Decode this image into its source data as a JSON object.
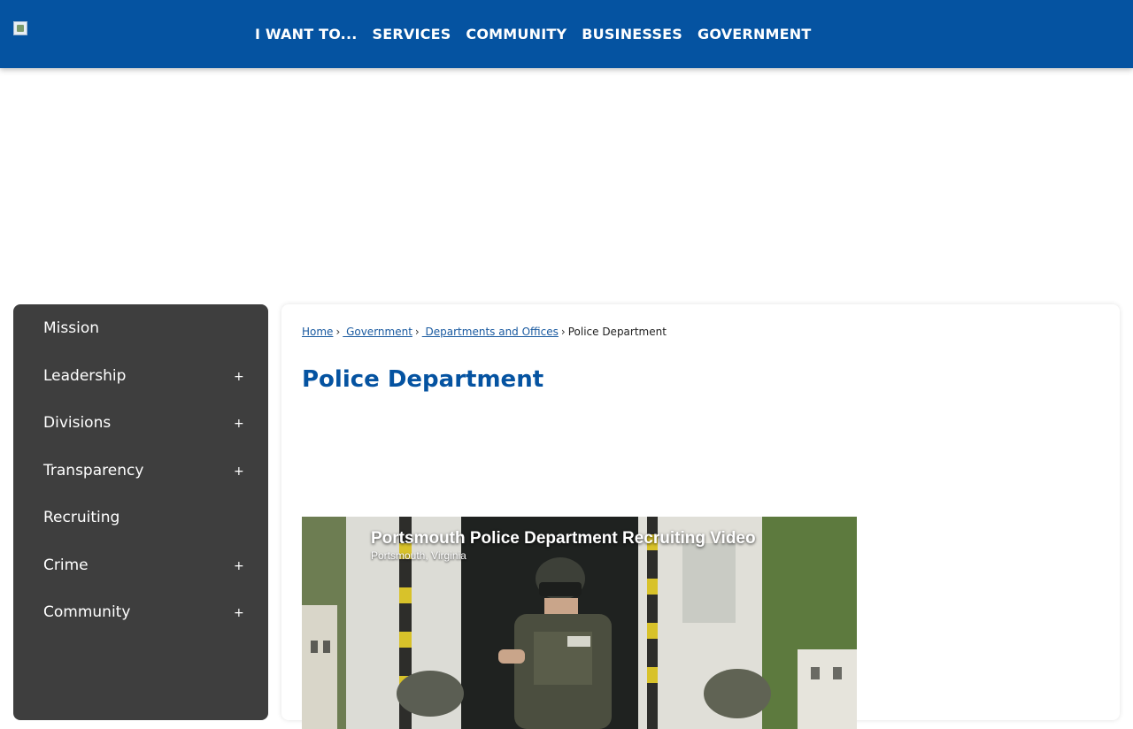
{
  "header": {
    "logo_icon": "broken-image-icon",
    "nav": [
      "I WANT TO...",
      "SERVICES",
      "COMMUNITY",
      "BUSINESSES",
      "GOVERNMENT"
    ]
  },
  "sidebar": {
    "items": [
      {
        "label": "Mission",
        "expandable": false
      },
      {
        "label": "Leadership",
        "expandable": true
      },
      {
        "label": "Divisions",
        "expandable": true
      },
      {
        "label": "Transparency",
        "expandable": true
      },
      {
        "label": "Recruiting",
        "expandable": false
      },
      {
        "label": "Crime",
        "expandable": true
      },
      {
        "label": "Community",
        "expandable": true
      }
    ],
    "plus_symbol": "+"
  },
  "breadcrumb": {
    "home": "Home",
    "government": " Government",
    "departments": " Departments and Offices",
    "current": "Police Department",
    "separator": "›"
  },
  "page": {
    "title": "Police Department"
  },
  "video": {
    "title": "Portsmouth Police Department Recruiting Video",
    "subtitle": "Portsmouth, Virginia"
  },
  "colors": {
    "header_bg": "#0553a1",
    "sidebar_bg": "#3e3e3e",
    "title": "#0553a1",
    "link": "#1a5aa0"
  }
}
